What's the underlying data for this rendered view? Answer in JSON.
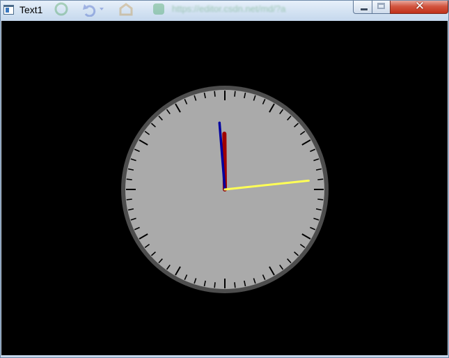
{
  "window": {
    "title": "Text1",
    "ghost_url": "https://editor.csdn.net/md/?a"
  },
  "clock": {
    "hour": 11,
    "minute": 59,
    "second": 14,
    "colors": {
      "background": "#000000",
      "face": "#aaaaaa",
      "rim": "#4d4d4d",
      "ticks": "#000000",
      "hour_hand": "#a00000",
      "minute_hand": "#0000a0",
      "second_hand": "#ffff55"
    },
    "tick_count": 60
  }
}
